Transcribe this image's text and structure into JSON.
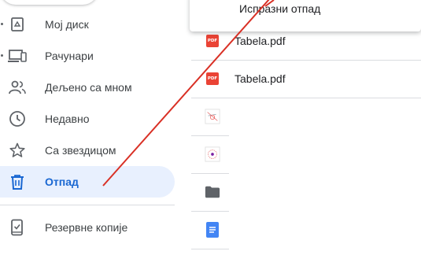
{
  "menu": {
    "empty_trash_label": "Испразни отпад"
  },
  "sidebar": {
    "items": [
      {
        "label": "Мој диск",
        "icon": "my-drive-icon"
      },
      {
        "label": "Рачунари",
        "icon": "computers-icon"
      },
      {
        "label": "Дељено са мном",
        "icon": "shared-with-me-icon"
      },
      {
        "label": "Недавно",
        "icon": "recent-clock-icon"
      },
      {
        "label": "Са звездицом",
        "icon": "star-icon"
      },
      {
        "label": "Отпад",
        "icon": "trash-icon",
        "active": true
      },
      {
        "label": "Резервне копије",
        "icon": "backups-icon"
      }
    ]
  },
  "files": [
    {
      "name": "Tabela.pdf",
      "type": "pdf"
    },
    {
      "name": "Tabela.pdf",
      "type": "pdf"
    },
    {
      "name": "",
      "type": "image"
    },
    {
      "name": "",
      "type": "image"
    },
    {
      "name": "",
      "type": "folder"
    },
    {
      "name": "",
      "type": "doc"
    }
  ],
  "colors": {
    "accent": "#1967d2",
    "active_bg": "#e8f0fe",
    "pdf": "#ea4335",
    "annotation": "#d93025"
  }
}
